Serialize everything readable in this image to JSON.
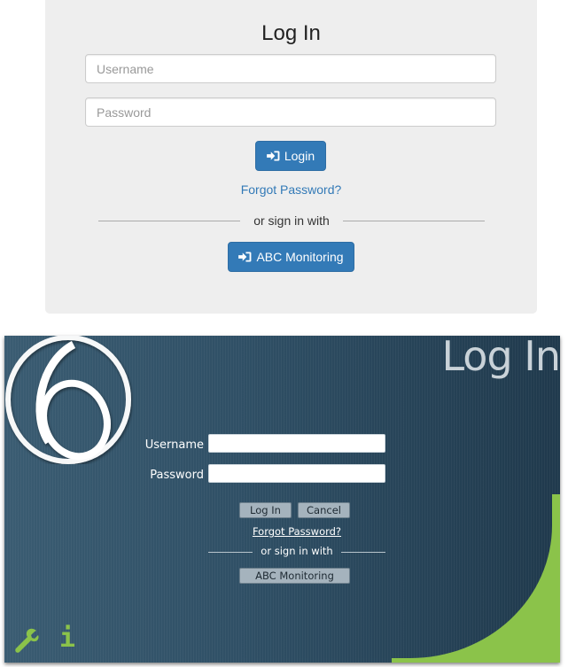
{
  "web_login": {
    "title": "Log In",
    "username_placeholder": "Username",
    "password_placeholder": "Password",
    "login_button": "Login",
    "forgot_password": "Forgot Password?",
    "divider_text": "or sign in with",
    "sso_button": "ABC Monitoring",
    "button_icon": "sign-in-icon",
    "colors": {
      "primary": "#337ab7",
      "card_bg": "#eeeeee",
      "link": "#337ab7"
    }
  },
  "desktop_login": {
    "title": "Log In",
    "logo": "swirl-logo",
    "username_label": "Username",
    "password_label": "Password",
    "username_value": "",
    "password_value": "",
    "login_button": "Log In",
    "cancel_button": "Cancel",
    "forgot_password": "Forgot Password?",
    "divider_text": "or sign in with",
    "sso_button": "ABC Monitoring",
    "footer_icons": [
      "wrench-icon",
      "info-icon"
    ],
    "info_glyph": "i",
    "colors": {
      "background": "#2f4f65",
      "accent": "#8bc34a",
      "button": "#a5b3bd"
    }
  }
}
